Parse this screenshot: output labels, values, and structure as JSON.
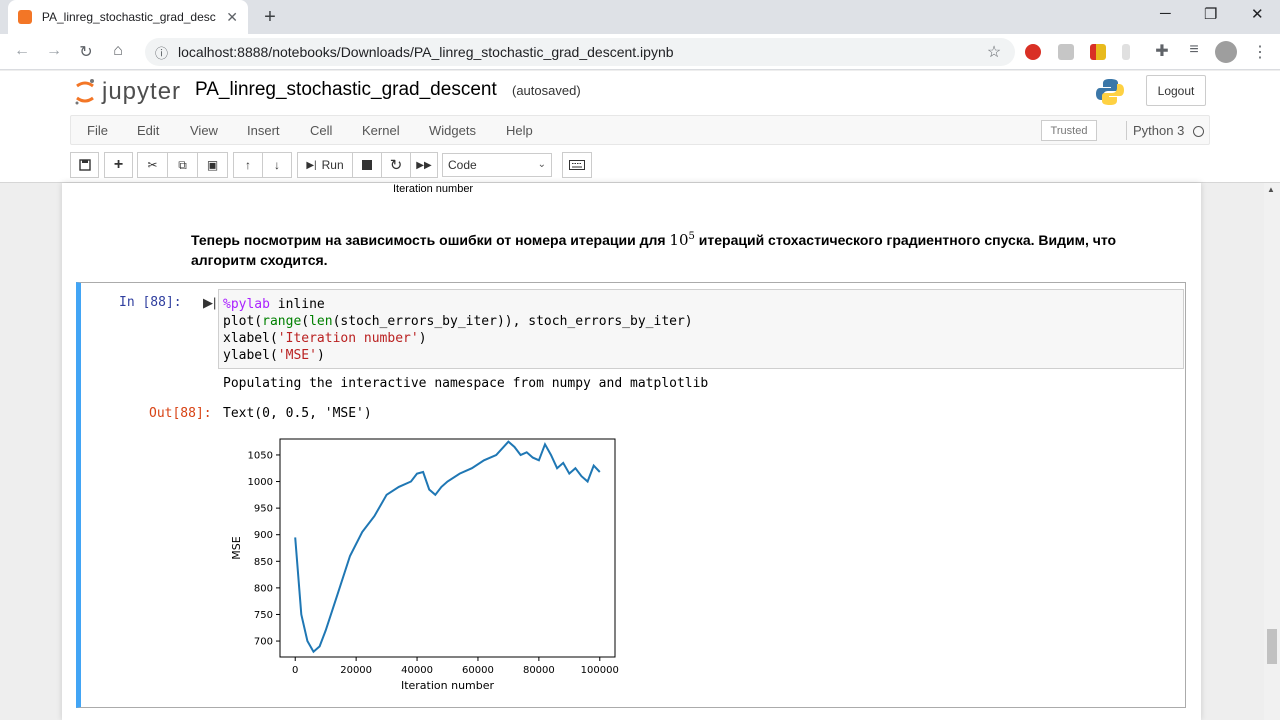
{
  "browser": {
    "tab_title": "PA_linreg_stochastic_grad_descent",
    "new_tab": "+",
    "url": "localhost:8888/notebooks/Downloads/PA_linreg_stochastic_grad_descent.ipynb"
  },
  "jupyter": {
    "logo_text": "jupyter",
    "notebook_name": "PA_linreg_stochastic_grad_descent",
    "autosaved": "(autosaved)",
    "logout": "Logout",
    "menu": [
      "File",
      "Edit",
      "View",
      "Insert",
      "Cell",
      "Kernel",
      "Widgets",
      "Help"
    ],
    "trusted": "Trusted",
    "kernel": "Python 3",
    "run_label": "Run",
    "cell_type": "Code"
  },
  "notebook": {
    "prev_xlabel": "Iteration number",
    "markdown_before": "Теперь посмотрим на зависимость ошибки от номера итерации для ",
    "markdown_math_base": "10",
    "markdown_math_exp": "5",
    "markdown_after": " итераций стохастического градиентного спуска. Видим, что алгоритм сходится.",
    "in_prompt": "In [88]:",
    "code": {
      "line1_magic": "%pylab",
      "line1_rest": " inline",
      "line2_a": "plot(",
      "line2_range": "range",
      "line2_b": "(",
      "line2_len": "len",
      "line2_c": "(stoch_errors_by_iter)), stoch_errors_by_iter)",
      "line3_a": "xlabel(",
      "line3_str": "'Iteration number'",
      "line3_b": ")",
      "line4_a": "ylabel(",
      "line4_str": "'MSE'",
      "line4_b": ")"
    },
    "stdout": "Populating the interactive namespace from numpy and matplotlib",
    "out_prompt": "Out[88]:",
    "out_text": "Text(0, 0.5, 'MSE')"
  },
  "chart_data": {
    "type": "line",
    "title": "",
    "xlabel": "Iteration number",
    "ylabel": "MSE",
    "xlim": [
      -5000,
      105000
    ],
    "ylim": [
      670,
      1080
    ],
    "xticks": [
      0,
      20000,
      40000,
      60000,
      80000,
      100000
    ],
    "yticks": [
      700,
      750,
      800,
      850,
      900,
      950,
      1000,
      1050
    ],
    "color": "#1f77b4",
    "x": [
      0,
      2000,
      4000,
      6000,
      8000,
      10000,
      14000,
      18000,
      22000,
      26000,
      30000,
      34000,
      38000,
      40000,
      42000,
      44000,
      46000,
      48000,
      50000,
      54000,
      58000,
      62000,
      66000,
      70000,
      72000,
      74000,
      76000,
      78000,
      80000,
      82000,
      84000,
      86000,
      88000,
      90000,
      92000,
      94000,
      96000,
      98000,
      100000
    ],
    "y": [
      895,
      750,
      700,
      680,
      690,
      720,
      790,
      860,
      905,
      935,
      975,
      990,
      1000,
      1015,
      1018,
      985,
      975,
      990,
      1000,
      1015,
      1025,
      1040,
      1050,
      1075,
      1065,
      1050,
      1055,
      1045,
      1040,
      1070,
      1050,
      1025,
      1035,
      1015,
      1025,
      1010,
      1000,
      1030,
      1018
    ]
  }
}
